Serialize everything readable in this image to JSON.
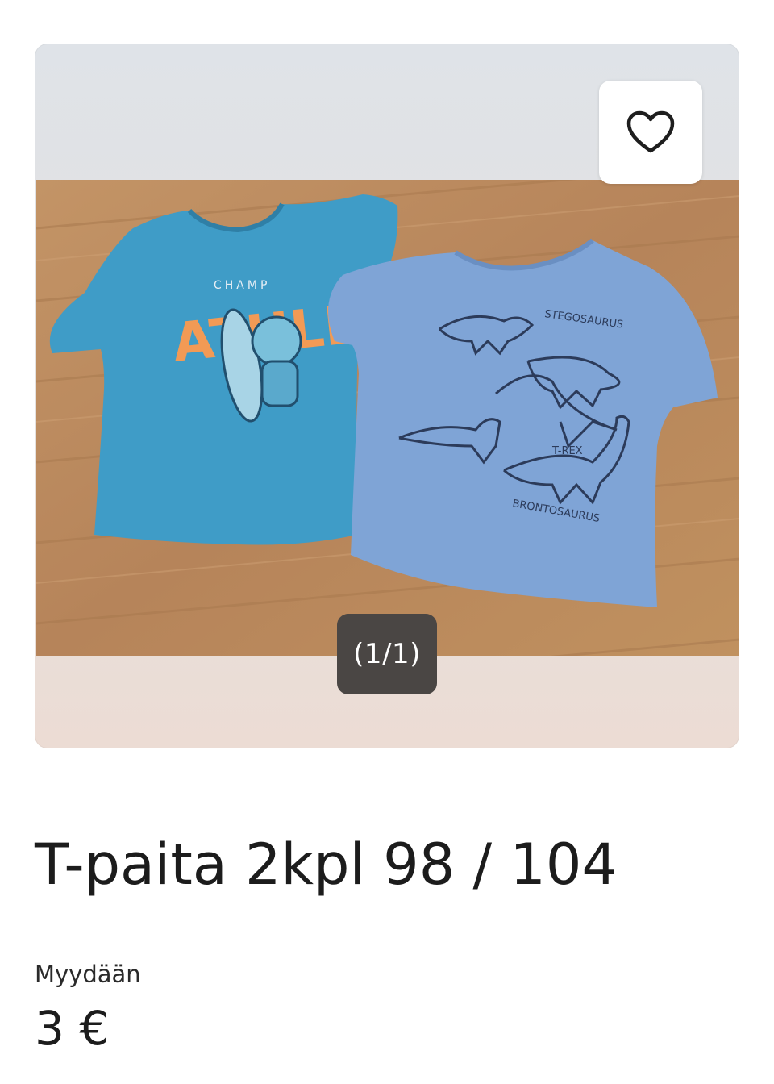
{
  "listing": {
    "title": "T-paita 2kpl 98  / 104",
    "sale_type": "Myydään",
    "price": "3 €"
  },
  "gallery": {
    "counter": "(1/1)",
    "favorite_icon": "heart-outline-icon"
  },
  "colors": {
    "counter_bg": "#4a4644",
    "wood": "#b9885a",
    "shirt_left": "#3f9cc7",
    "shirt_right": "#7fa4d6",
    "print_orange": "#f29a55"
  }
}
